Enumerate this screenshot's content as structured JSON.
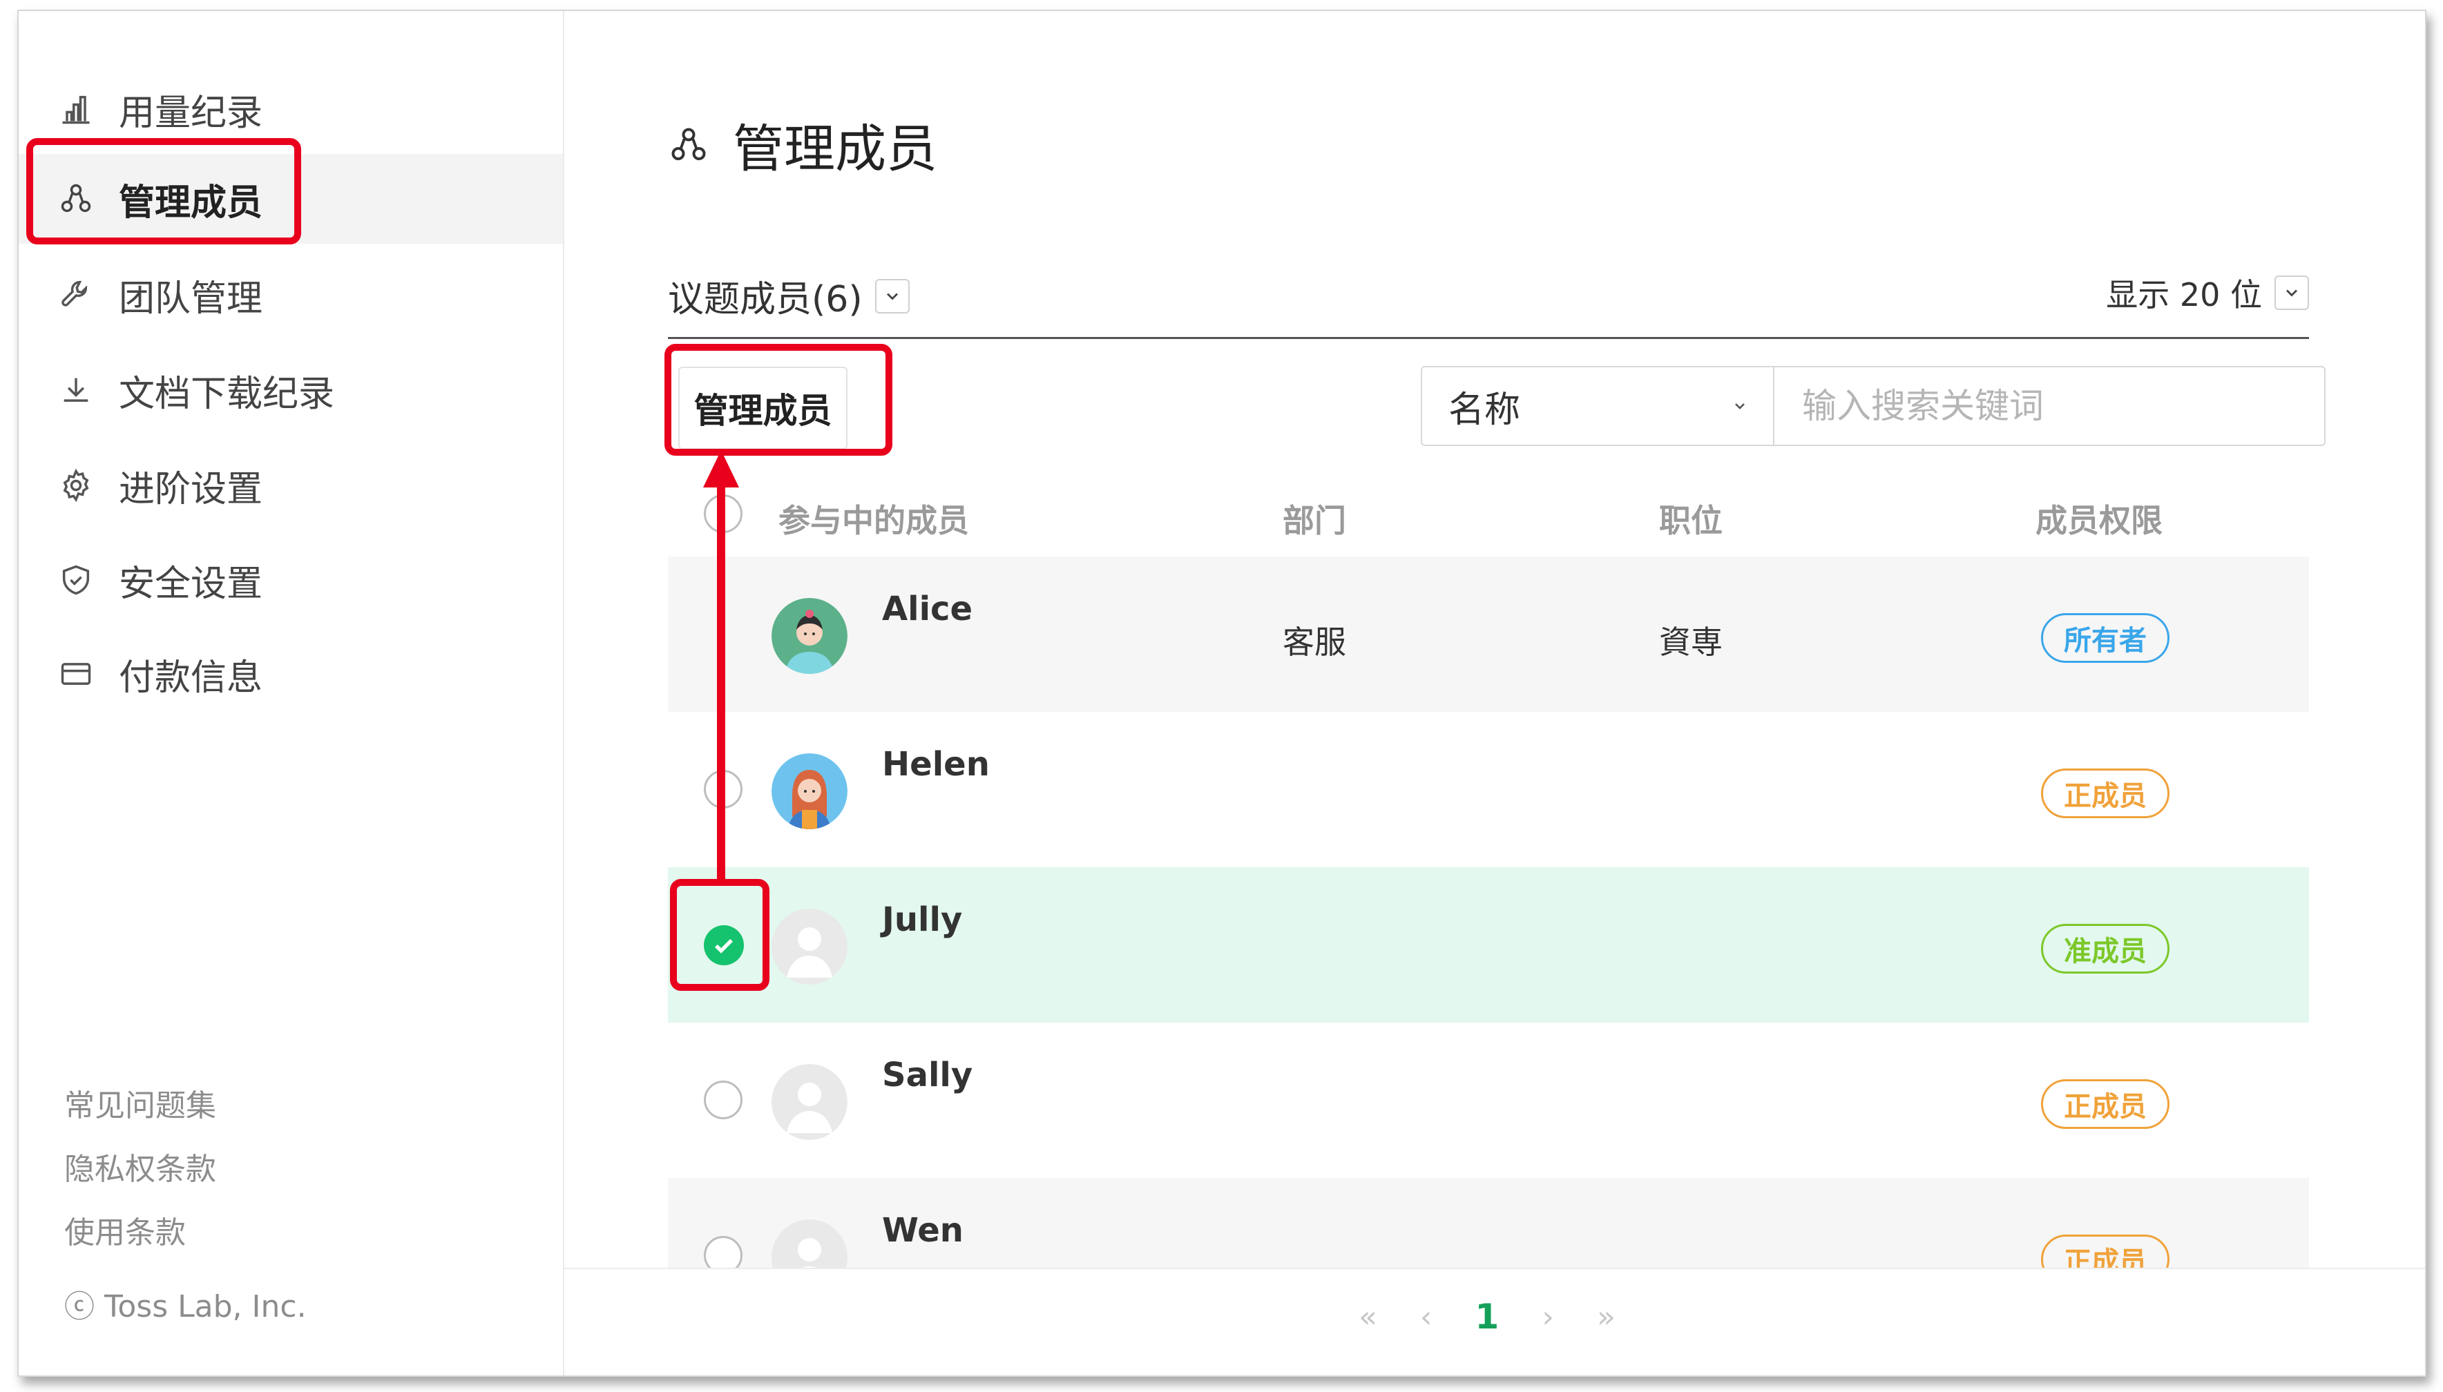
{
  "sidebar": {
    "items": [
      {
        "label": "用量纪录",
        "icon": "bar-chart-icon"
      },
      {
        "label": "管理成员",
        "icon": "members-icon"
      },
      {
        "label": "团队管理",
        "icon": "wrench-icon"
      },
      {
        "label": "文档下载纪录",
        "icon": "download-icon"
      },
      {
        "label": "进阶设置",
        "icon": "gear-icon"
      },
      {
        "label": "安全设置",
        "icon": "shield-icon"
      },
      {
        "label": "付款信息",
        "icon": "credit-card-icon"
      }
    ],
    "active_index": 1,
    "footer": [
      "常见问题集",
      "隐私权条款",
      "使用条款"
    ],
    "copyright": "ⓒ Toss Lab, Inc."
  },
  "main": {
    "title": "管理成员",
    "topic_members": "议题成员(6)",
    "show_count": "显示 20 位",
    "manage_button": "管理成员",
    "search": {
      "field": "名称",
      "placeholder": "输入搜索关键词"
    },
    "columns": [
      "参与中的成员",
      "部门",
      "职位",
      "成员权限"
    ],
    "rows": [
      {
        "name": "Alice",
        "dept": "客服",
        "position": "資専",
        "role": "所有者",
        "role_color": "#3aa6ea",
        "selected": false
      },
      {
        "name": "Helen",
        "dept": "",
        "position": "",
        "role": "正成员",
        "role_color": "#f0a23a",
        "selected": false
      },
      {
        "name": "Jully",
        "dept": "",
        "position": "",
        "role": "准成员",
        "role_color": "#7cc82a",
        "selected": true
      },
      {
        "name": "Sally",
        "dept": "",
        "position": "",
        "role": "正成员",
        "role_color": "#f0a23a",
        "selected": false
      },
      {
        "name": "Wen",
        "dept": "",
        "position": "",
        "role": "正成员",
        "role_color": "#f0a23a",
        "selected": false
      }
    ],
    "pagination": {
      "first": "«",
      "prev": "‹",
      "current": "1",
      "next": "›",
      "last": "»"
    }
  },
  "colors": {
    "highlight": "#e8001c",
    "check": "#15c26d",
    "selected_row": "#e3f8ef"
  }
}
